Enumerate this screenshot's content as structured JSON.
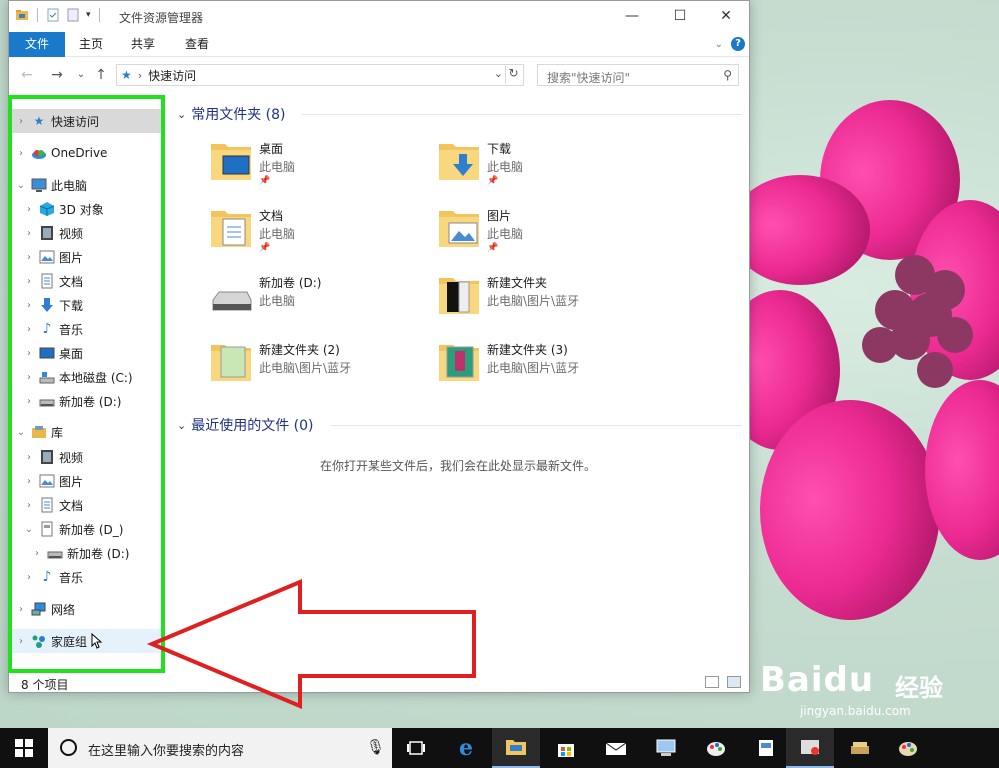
{
  "window": {
    "title": "文件资源管理器",
    "controls": {
      "minimize": "—",
      "maximize": "☐",
      "close": "✕"
    }
  },
  "ribbon": {
    "tabs": [
      "文件",
      "主页",
      "共享",
      "查看"
    ],
    "help": "?"
  },
  "address": {
    "crumb": "快速访问",
    "search_placeholder": "搜索\"快速访问\""
  },
  "nav": {
    "items": [
      {
        "label": "快速访问",
        "level": 0,
        "expanded": false,
        "selected": true,
        "icon": "star-icon"
      },
      {
        "label": "OneDrive",
        "level": 0,
        "expanded": false,
        "icon": "onedrive-icon"
      },
      {
        "label": "此电脑",
        "level": 0,
        "expanded": true,
        "icon": "computer-icon"
      },
      {
        "label": "3D 对象",
        "level": 1,
        "expanded": false,
        "icon": "cube-icon"
      },
      {
        "label": "视频",
        "level": 1,
        "expanded": false,
        "icon": "video-icon"
      },
      {
        "label": "图片",
        "level": 1,
        "expanded": false,
        "icon": "picture-icon"
      },
      {
        "label": "文档",
        "level": 1,
        "expanded": false,
        "icon": "document-icon"
      },
      {
        "label": "下载",
        "level": 1,
        "expanded": false,
        "icon": "download-icon"
      },
      {
        "label": "音乐",
        "level": 1,
        "expanded": false,
        "icon": "music-icon"
      },
      {
        "label": "桌面",
        "level": 1,
        "expanded": false,
        "icon": "desktop-icon"
      },
      {
        "label": "本地磁盘 (C:)",
        "level": 1,
        "expanded": false,
        "icon": "drive-c-icon"
      },
      {
        "label": "新加卷 (D:)",
        "level": 1,
        "expanded": false,
        "icon": "drive-icon"
      },
      {
        "label": "库",
        "level": 0,
        "expanded": true,
        "icon": "library-icon"
      },
      {
        "label": "视频",
        "level": 1,
        "expanded": false,
        "icon": "video-icon"
      },
      {
        "label": "图片",
        "level": 1,
        "expanded": false,
        "icon": "picture-icon"
      },
      {
        "label": "文档",
        "level": 1,
        "expanded": false,
        "icon": "document-icon"
      },
      {
        "label": "新加卷 (D_)",
        "level": 1,
        "expanded": true,
        "icon": "library-doc-icon"
      },
      {
        "label": "新加卷 (D:)",
        "level": 2,
        "expanded": false,
        "icon": "drive-icon"
      },
      {
        "label": "音乐",
        "level": 1,
        "expanded": false,
        "icon": "music-icon"
      },
      {
        "label": "网络",
        "level": 0,
        "expanded": false,
        "icon": "network-icon"
      },
      {
        "label": "家庭组",
        "level": 0,
        "expanded": false,
        "icon": "homegroup-icon"
      }
    ]
  },
  "frequent": {
    "heading": "常用文件夹 (8)",
    "tiles": [
      {
        "name": "桌面",
        "sub": "此电脑",
        "pinned": true,
        "icon": "desktop-folder-icon"
      },
      {
        "name": "下载",
        "sub": "此电脑",
        "pinned": true,
        "icon": "download-folder-icon"
      },
      {
        "name": "文档",
        "sub": "此电脑",
        "pinned": true,
        "icon": "documents-folder-icon"
      },
      {
        "name": "图片",
        "sub": "此电脑",
        "pinned": true,
        "icon": "pictures-folder-icon"
      },
      {
        "name": "新加卷 (D:)",
        "sub": "此电脑",
        "pinned": false,
        "icon": "drive-icon"
      },
      {
        "name": "新建文件夹",
        "sub": "此电脑\\图片\\蓝牙",
        "pinned": false,
        "icon": "folder-icon"
      },
      {
        "name": "新建文件夹 (2)",
        "sub": "此电脑\\图片\\蓝牙",
        "pinned": false,
        "icon": "folder-icon"
      },
      {
        "name": "新建文件夹 (3)",
        "sub": "此电脑\\图片\\蓝牙",
        "pinned": false,
        "icon": "folder-icon"
      }
    ]
  },
  "recent": {
    "heading": "最近使用的文件 (0)",
    "empty_message": "在你打开某些文件后，我们会在此处显示最新文件。"
  },
  "status": {
    "count": "8 个项目"
  },
  "taskbar": {
    "search_placeholder": "在这里输入你要搜索的内容"
  },
  "watermark": {
    "brand": "Baidu",
    "cn": "经验",
    "url": "jingyan.baidu.com"
  },
  "colors": {
    "accent": "#1979ca",
    "highlight_box": "#20e020",
    "arrow": "#e02020",
    "heading": "#1e3287"
  }
}
